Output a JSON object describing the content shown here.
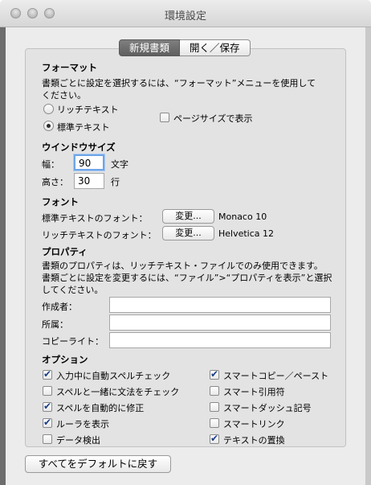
{
  "window": {
    "title": "環境設定"
  },
  "tabs": [
    {
      "label": "新規書類",
      "selected": true
    },
    {
      "label": "開く／保存",
      "selected": false
    }
  ],
  "format": {
    "heading": "フォーマット",
    "description_line1": "書類ごとに設定を選択するには、“フォーマット”メニューを使用して",
    "description_line2": "ください。",
    "rich_text_label": "リッチテキスト",
    "plain_text_label": "標準テキスト",
    "selected": "plain",
    "page_size_label": "ページサイズで表示",
    "page_size_checked": false
  },
  "window_size": {
    "heading": "ウインドウサイズ",
    "width_label": "幅：",
    "width_value": "90",
    "width_unit": "文字",
    "height_label": "高さ：",
    "height_value": "30",
    "height_unit": "行"
  },
  "font": {
    "heading": "フォント",
    "plain_label": "標準テキストのフォント：",
    "plain_button": "変更...",
    "plain_value": "Monaco 10",
    "rich_label": "リッチテキストのフォント：",
    "rich_button": "変更...",
    "rich_value": "Helvetica 12"
  },
  "properties": {
    "heading": "プロパティ",
    "description_line1": "書類のプロパティは、リッチテキスト・ファイルでのみ使用できます。",
    "description_line2": "書類ごとに設定を変更するには、“ファイル”>“プロパティを表示”と選択",
    "description_line3": "してください。",
    "author_label": "作成者：",
    "author_value": "",
    "organization_label": "所属：",
    "organization_value": "",
    "copyright_label": "コピーライト：",
    "copyright_value": ""
  },
  "options": {
    "heading": "オプション",
    "left": [
      {
        "label": "入力中に自動スペルチェック",
        "checked": true
      },
      {
        "label": "スペルと一緒に文法をチェック",
        "checked": false
      },
      {
        "label": "スペルを自動的に修正",
        "checked": true
      },
      {
        "label": "ルーラを表示",
        "checked": true
      },
      {
        "label": "データ検出",
        "checked": false
      }
    ],
    "right": [
      {
        "label": "スマートコピー／ペースト",
        "checked": true
      },
      {
        "label": "スマート引用符",
        "checked": false
      },
      {
        "label": "スマートダッシュ記号",
        "checked": false
      },
      {
        "label": "スマートリンク",
        "checked": false
      },
      {
        "label": "テキストの置換",
        "checked": true
      }
    ]
  },
  "footer": {
    "reset_button": "すべてをデフォルトに戻す"
  }
}
